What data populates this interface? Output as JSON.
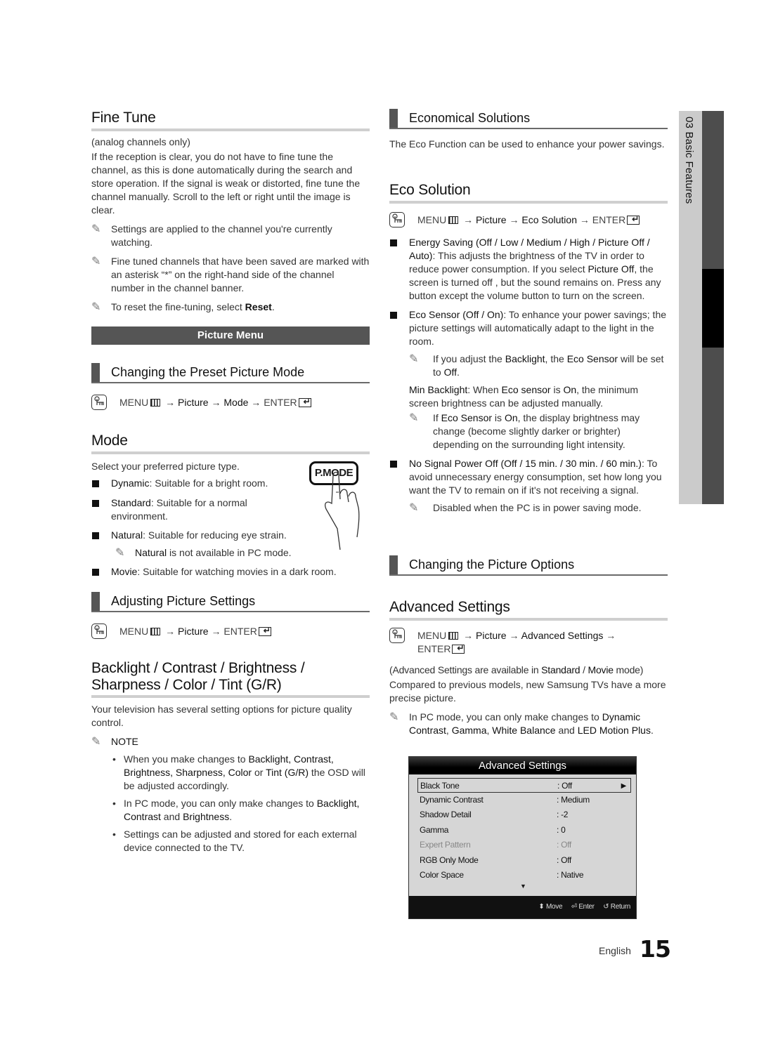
{
  "left": {
    "fine_tune": {
      "title": "Fine Tune",
      "subtitle": "(analog channels only)",
      "body": "If the reception is clear, you do not have to fine tune the channel, as this is done automatically during the search and store operation. If the signal is weak or distorted, fine tune the channel manually. Scroll to the left or right until the image is clear.",
      "note1": "Settings are applied to the channel you're currently watching.",
      "note2": "Fine tuned channels that have been saved are marked with an asterisk “*” on the right-hand side of the channel number in the channel banner.",
      "note3_pre": "To reset the fine-tuning, select ",
      "note3_bold": "Reset",
      "note3_post": "."
    },
    "picture_menu_banner": "Picture Menu",
    "preset_mode": {
      "title": "Changing the Preset Picture Mode",
      "path": {
        "menu": "MENU",
        "a1": " → ",
        "p1": "Picture",
        "a2": " → ",
        "p2": "Mode",
        "a3": " → ",
        "enter": "ENTER"
      }
    },
    "mode": {
      "title": "Mode",
      "intro": "Select your preferred picture type.",
      "button_label": "P.MODE",
      "items": [
        {
          "term": "Dynamic",
          "desc": ": Suitable for a bright room."
        },
        {
          "term": "Standard",
          "desc": ": Suitable for a normal environment."
        },
        {
          "term": "Natural",
          "desc": ": Suitable for reducing eye strain."
        },
        {
          "term": "Movie",
          "desc": ": Suitable for watching movies in a dark room."
        }
      ],
      "natural_note_bold": "Natural",
      "natural_note": " is not available in PC mode."
    },
    "adjusting": {
      "title": "Adjusting Picture Settings",
      "path": {
        "menu": "MENU",
        "a1": " → ",
        "p1": "Picture",
        "a2": " → ",
        "enter": "ENTER"
      }
    },
    "backlight": {
      "title_line1": "Backlight / Contrast / Brightness /",
      "title_line2": "Sharpness / Color / Tint (G/R)",
      "body": "Your television has several setting options for picture quality control.",
      "note_label": "NOTE",
      "bullets": [
        {
          "t1": "When you make changes to ",
          "b1": "Backlight, Contrast, Brightness, Sharpness, Color",
          "t2": " or ",
          "b2": "Tint (G/R)",
          "t3": " the OSD will be adjusted accordingly."
        },
        {
          "t1": "In PC mode, you can only make changes to ",
          "b1": "Backlight, Contrast",
          "t2": " and ",
          "b2": "Brightness",
          "t3": "."
        },
        {
          "t1": "Settings can be adjusted and stored for each external device connected to the TV."
        }
      ]
    }
  },
  "right": {
    "economical": {
      "title": "Economical Solutions",
      "body": "The Eco Function can be used to enhance your power savings."
    },
    "eco_solution": {
      "title": "Eco Solution",
      "path": {
        "menu": "MENU",
        "a1": " → ",
        "p1": "Picture",
        "a2": " → ",
        "p2": "Eco Solution",
        "a3": " → ",
        "enter": "ENTER"
      },
      "energy_bold": "Energy Saving (Off / Low / Medium / High / Picture Off / Auto)",
      "energy_t1": ": This adjusts the brightness of the TV in order to reduce power consumption. If you select ",
      "energy_b2": "Picture Off",
      "energy_t2": ", the screen is turned off , but the sound remains on. Press any button except the volume button to turn on the screen.",
      "eco_sensor_bold": "Eco Sensor (Off / On)",
      "eco_sensor_t": ": To enhance your power savings; the picture settings will automatically adapt to the light in the room.",
      "eco_note": {
        "t1": "If you adjust the ",
        "b1": "Backlight",
        "t2": ", the ",
        "b2": "Eco Sensor",
        "t3": " will be set to ",
        "b3": "Off",
        "t4": "."
      },
      "min_backlight": {
        "b1": "Min Backlight",
        "t1": ": When ",
        "b2": "Eco sensor",
        "t2": " is ",
        "b3": "On",
        "t3": ", the minimum screen brightness can be adjusted manually."
      },
      "min_note": {
        "t1": "If ",
        "b1": "Eco Sensor",
        "t2": " is ",
        "b2": "On",
        "t3": ", the display brightness may change (become slightly darker or brighter) depending on the surrounding light intensity."
      },
      "no_signal_bold": "No Signal Power Off (Off / 15 min. / 30 min. / 60 min.)",
      "no_signal_t": ": To avoid unnecessary energy consumption, set how long you want the TV to remain on if it's not receiving a signal.",
      "no_signal_note": "Disabled when the PC is in power saving mode."
    },
    "options": {
      "title": "Changing the Picture Options"
    },
    "advanced": {
      "title": "Advanced Settings",
      "path": {
        "menu": "MENU",
        "a1": " → ",
        "p1": "Picture",
        "a2": " → ",
        "p2": "Advanced Settings",
        "a3": " →",
        "enter": "ENTER"
      },
      "avail": {
        "t1": "(Advanced Settings are available in ",
        "b1": "Standard",
        "t2": " / ",
        "b2": "Movie",
        "t3": " mode)"
      },
      "body": "Compared to previous models, new Samsung TVs have a more precise picture.",
      "note": {
        "t1": "In PC mode, you can only make changes to ",
        "b1": "Dynamic Contrast",
        "t2": ", ",
        "b2": "Gamma",
        "t3": ", ",
        "b3": "White Balance",
        "t4": " and ",
        "b4": "LED Motion Plus",
        "t5": "."
      }
    }
  },
  "osd": {
    "title": "Advanced Settings",
    "rows": [
      {
        "label": "Black Tone",
        "value": ": Off",
        "selected": true
      },
      {
        "label": "Dynamic Contrast",
        "value": ": Medium"
      },
      {
        "label": "Shadow Detail",
        "value": ": -2"
      },
      {
        "label": "Gamma",
        "value": ": 0"
      },
      {
        "label": "Expert Pattern",
        "value": ": Off",
        "disabled": true
      },
      {
        "label": "RGB Only Mode",
        "value": ": Off"
      },
      {
        "label": "Color Space",
        "value": ": Native"
      }
    ],
    "footer": {
      "move": "Move",
      "enter": "Enter",
      "return": "Return"
    }
  },
  "side_tab": {
    "label": "03  Basic Features"
  },
  "footer": {
    "language": "English",
    "page_number": "15"
  }
}
